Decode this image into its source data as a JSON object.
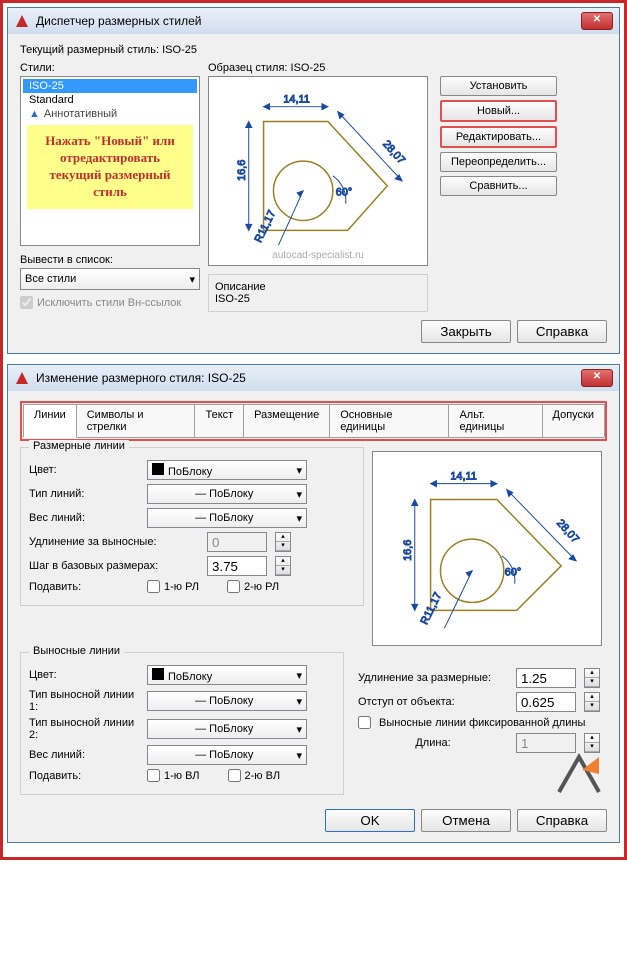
{
  "dialog1": {
    "title": "Диспетчер размерных стилей",
    "current_label": "Текущий размерный стиль: ISO-25",
    "styles_label": "Стили:",
    "sample_label": "Образец стиля: ISO-25",
    "styles": {
      "iso25": "ISO-25",
      "standard": "Standard",
      "annotative": "Аннотативный"
    },
    "note_l1": "Нажать \"Новый\" или",
    "note_l2": "отредактировать",
    "note_l3": "текущий размерный",
    "note_l4": "стиль",
    "list_label": "Вывести в список:",
    "list_value": "Все стили",
    "exclude_label": "Исключить стили Вн-ссылок",
    "desc_label": "Описание",
    "desc_value": "ISO-25",
    "btn_set": "Установить",
    "btn_new": "Новый...",
    "btn_edit": "Редактировать...",
    "btn_override": "Переопределить...",
    "btn_compare": "Сравнить...",
    "btn_close": "Закрыть",
    "btn_help": "Справка",
    "watermark": "autocad-specialist.ru",
    "dim1": "14,11",
    "dim2": "16,6",
    "dim3": "28,07",
    "dim4": "R11,17",
    "dim5": "60°"
  },
  "dialog2": {
    "title": "Изменение размерного стиля: ISO-25",
    "tabs": [
      "Линии",
      "Символы и стрелки",
      "Текст",
      "Размещение",
      "Основные единицы",
      "Альт. единицы",
      "Допуски"
    ],
    "grp_dimlines": "Размерные линии",
    "grp_extlines": "Выносные линии",
    "lbl_color": "Цвет:",
    "lbl_linetype": "Тип линий:",
    "lbl_lineweight": "Вес линий:",
    "lbl_extend": "Удлинение за выносные:",
    "lbl_baseline": "Шаг в базовых размерах:",
    "lbl_suppress": "Подавить:",
    "lbl_ext1type": "Тип выносной линии 1:",
    "lbl_ext2type": "Тип выносной линии 2:",
    "byblock": "ПоБлоку",
    "chk_1rl": "1-ю РЛ",
    "chk_2rl": "2-ю РЛ",
    "chk_1vl": "1-ю ВЛ",
    "chk_2vl": "2-ю ВЛ",
    "lbl_ext_beyond": "Удлинение за размерные:",
    "lbl_offset": "Отступ от объекта:",
    "lbl_fixed": "Выносные линии фиксированной длины",
    "lbl_length": "Длина:",
    "val_extend": "0",
    "val_baseline": "3.75",
    "val_ext_beyond": "1.25",
    "val_offset": "0.625",
    "val_length": "1",
    "btn_ok": "OK",
    "btn_cancel": "Отмена",
    "btn_help": "Справка",
    "dim1": "14,11",
    "dim2": "16,6",
    "dim3": "28,07",
    "dim4": "R11,17",
    "dim5": "60°"
  }
}
